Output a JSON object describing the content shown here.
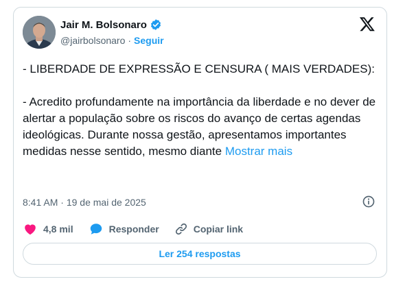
{
  "colors": {
    "accent": "#1d9bf0",
    "like": "#f91880",
    "text": "#0f1419",
    "secondary": "#536471",
    "border": "#cfd9de"
  },
  "author": {
    "display_name": "Jair M. Bolsonaro",
    "handle": "@jairbolsonaro",
    "separator": "·",
    "follow_label": "Seguir",
    "verified_icon": "verified-badge-icon",
    "avatar": "profile-photo"
  },
  "logo": "x-logo-icon",
  "tweet": {
    "paragraph_1": "- LIBERDADE DE EXPRESSÃO E CENSURA ( MAIS VERDADES):",
    "paragraph_2": "- Acredito profundamente na importância da liberdade e no dever de alertar a população sobre os riscos do avanço de certas agendas ideológicas. Durante nossa gestão, apresentamos importantes medidas nesse sentido, mesmo diante",
    "show_more": "Mostrar mais"
  },
  "meta": {
    "time": "8:41 AM",
    "separator": "·",
    "date": "19 de mai de 2025",
    "info_icon": "info-icon"
  },
  "actions": {
    "like_icon": "heart-icon",
    "like_count": "4,8 mil",
    "reply_icon": "reply-bubble-icon",
    "reply_label": "Responder",
    "copy_icon": "link-icon",
    "copy_label": "Copiar link"
  },
  "read_replies": "Ler 254 respostas"
}
